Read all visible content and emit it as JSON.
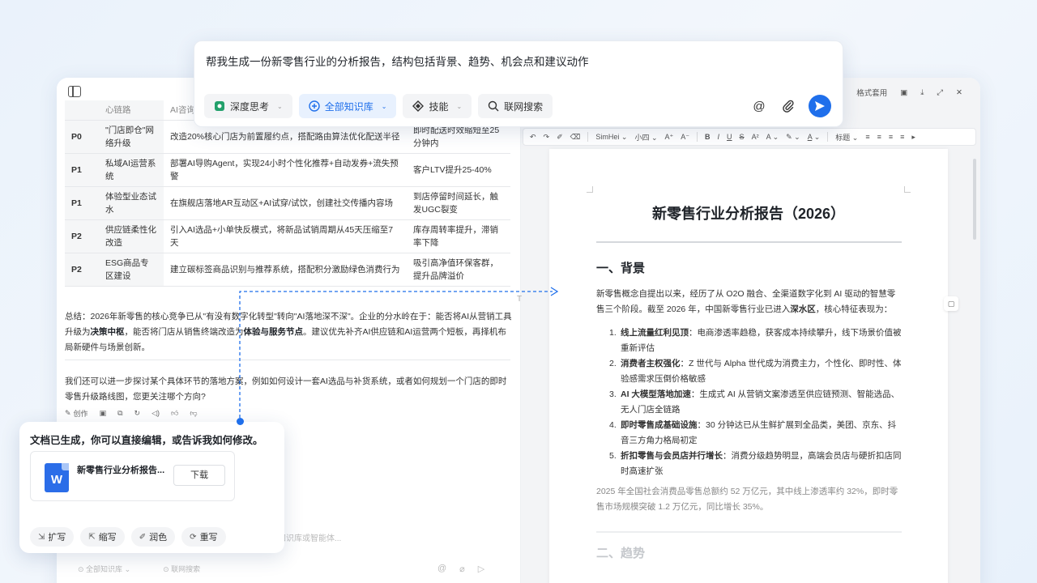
{
  "prompt": {
    "text": "帮我生成一份新零售行业的分析报告，结构包括背景、趋势、机会点和建议动作",
    "chips": [
      {
        "label": "深度思考",
        "icon": "deep-think-icon",
        "active": false
      },
      {
        "label": "全部知识库",
        "icon": "knowledge-base-icon",
        "active": true
      },
      {
        "label": "技能",
        "icon": "skills-icon",
        "active": false
      },
      {
        "label": "联网搜索",
        "icon": "web-search-icon",
        "active": false
      }
    ]
  },
  "left": {
    "cut_row": {
      "c1": "",
      "c2": "心链路",
      "c3": "AI咨询",
      "c4": ""
    },
    "table_rows": [
      {
        "priority": "P0",
        "name": "\"门店即仓\"网络升级",
        "action": "改造20%核心门店为前置履约点，搭配路由算法优化配送半径",
        "effect": "即时配送时效缩短至25分钟内"
      },
      {
        "priority": "P1",
        "name": "私域AI运营系统",
        "action": "部署AI导购Agent，实现24小时个性化推荐+自动发券+流失预警",
        "effect": "客户LTV提升25-40%"
      },
      {
        "priority": "P1",
        "name": "体验型业态试水",
        "action": "在旗舰店落地AR互动区+AI试穿/试饮，创建社交传播内容场",
        "effect": "到店停留时间延长，触发UGC裂变"
      },
      {
        "priority": "P2",
        "name": "供应链柔性化改造",
        "action": "引入AI选品+小单快反模式，将新品试销周期从45天压缩至7天",
        "effect": "库存周转率提升，滞销率下降"
      },
      {
        "priority": "P2",
        "name": "ESG商品专区建设",
        "action": "建立碳标签商品识别与推荐系统，搭配积分激励绿色消费行为",
        "effect": "吸引高净值环保客群，提升品牌溢价"
      }
    ],
    "summary_prefix": "总结：2026年新零售的核心竞争已从\"有没有数字化转型\"转向\"AI落地深不深\"。企业的分水岭在于：能否将AI从营销工具升级为",
    "summary_bold1": "决策中枢",
    "summary_mid": "，能否将门店从销售终端改造为",
    "summary_bold2": "体验与服务节点",
    "summary_suffix": "。建议优先补齐AI供应链和AI运营两个短板，再择机布局新硬件与场景创新。",
    "followup": "我们还可以进一步探讨某个具体环节的落地方案，例如如何设计一套AI选品与补货系统，或者如何规划一个门店的即时零售升级路线图，您更关注哪个方向?",
    "actions": {
      "create": "创作"
    },
    "input_hint": "选择知识库或智能体...",
    "bottom_kb": "全部知识库",
    "bottom_search": "联网搜索"
  },
  "right": {
    "topbar_label": "格式套用",
    "toolbar": {
      "font": "SimHei",
      "size": "小四",
      "style": "标题"
    },
    "doc": {
      "title": "新零售行业分析报告（2026）",
      "h1": "一、背景",
      "intro_prefix": "新零售概念自提出以来，经历了从 O2O 融合、全渠道数字化到 AI 驱动的智慧零售三个阶段。截至 2026 年，中国新零售行业已进入",
      "intro_bold": "深水区",
      "intro_suffix": "，核心特征表现为：",
      "list": [
        {
          "num": "1.",
          "bold": "线上流量红利见顶",
          "text": "：电商渗透率趋稳，获客成本持续攀升，线下场景价值被重新评估"
        },
        {
          "num": "2.",
          "bold": "消费者主权强化",
          "text": "：Z 世代与 Alpha 世代成为消费主力，个性化、即时性、体验感需求压倒价格敏感"
        },
        {
          "num": "3.",
          "bold": "AI 大模型落地加速",
          "text": "：生成式 AI 从营销文案渗透至供应链预测、智能选品、无人门店全链路"
        },
        {
          "num": "4.",
          "bold": "即时零售成基础设施",
          "text": "：30 分钟达已从生鲜扩展到全品类，美团、京东、抖音三方角力格局初定"
        },
        {
          "num": "5.",
          "bold": "折扣零售与会员店并行增长",
          "text": "：消费分级趋势明显，高端会员店与硬折扣店同时高速扩张"
        }
      ],
      "stat": "2025 年全国社会消费品零售总额约 52 万亿元，其中线上渗透率约 32%，即时零售市场规模突破 1.2 万亿元，同比增长 35%。",
      "h2": "二、趋势"
    }
  },
  "gen_card": {
    "title": "文档已生成，你可以直接编辑，或告诉我如何修改。",
    "file_icon_letter": "W",
    "file_name": "新零售行业分析报告...",
    "download": "下载",
    "actions": [
      {
        "label": "扩写",
        "icon": "expand-icon"
      },
      {
        "label": "缩写",
        "icon": "shrink-icon"
      },
      {
        "label": "润色",
        "icon": "polish-icon"
      },
      {
        "label": "重写",
        "icon": "rewrite-icon"
      }
    ]
  },
  "colors": {
    "accent": "#1f6feb",
    "chip_active_bg": "#e8f1fe"
  }
}
